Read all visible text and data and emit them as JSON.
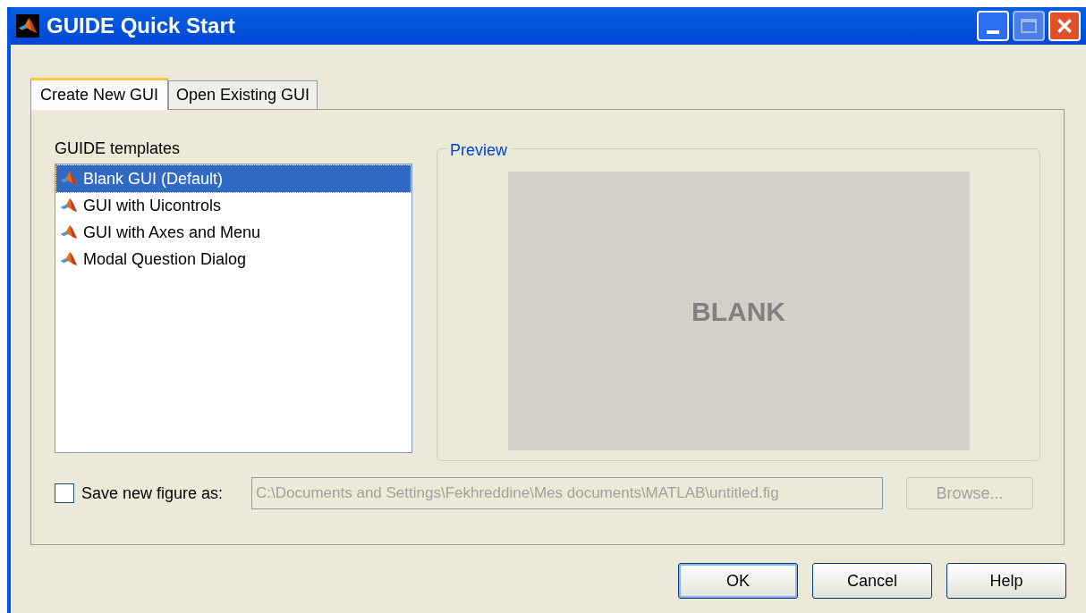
{
  "window": {
    "title": "GUIDE Quick Start"
  },
  "tabs": [
    {
      "label": "Create New GUI",
      "selected": true
    },
    {
      "label": "Open Existing GUI",
      "selected": false
    }
  ],
  "templates": {
    "label": "GUIDE templates",
    "items": [
      {
        "label": "Blank GUI (Default)",
        "selected": true
      },
      {
        "label": "GUI with Uicontrols",
        "selected": false
      },
      {
        "label": "GUI with Axes and Menu",
        "selected": false
      },
      {
        "label": "Modal Question Dialog",
        "selected": false
      }
    ]
  },
  "preview": {
    "title": "Preview",
    "text": "BLANK"
  },
  "save": {
    "label": "Save new figure as:",
    "checked": false,
    "path": "C:\\Documents and Settings\\Fekhreddine\\Mes documents\\MATLAB\\untitled.fig",
    "path_disabled": true,
    "browse": {
      "label": "Browse...",
      "disabled": true
    }
  },
  "buttons": [
    {
      "label": "OK",
      "default": true
    },
    {
      "label": "Cancel",
      "default": false
    },
    {
      "label": "Help",
      "default": false
    }
  ]
}
